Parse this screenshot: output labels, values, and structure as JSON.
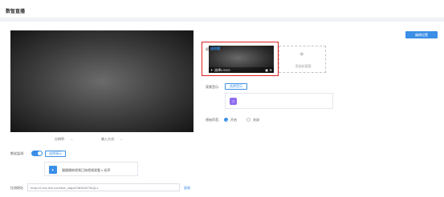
{
  "page": {
    "title": "数智直播",
    "primary_button": "编辑设置"
  },
  "preview": {
    "resolution_label": "分辨率:",
    "resolution_value": "--",
    "input_mode_label": "输入方式:",
    "input_mode_value": "--"
  },
  "settings": {
    "auto_play_label": "数说监测:",
    "select_video_button": "选择演示",
    "info_text": "慢慢播映视频已按视频观看 n 份声",
    "pull_url_label": "拉流地址:",
    "pull_url_value": "rtmp://2.xxx-live.com/live_xtapi/13630/ATXkQLL",
    "copy_link": "复制"
  },
  "cover": {
    "label": "视频:",
    "brand_text": "迪知播",
    "caption": "选择LOGO",
    "add_label": "添加封面图"
  },
  "music": {
    "label": "背景音乐:",
    "select_button": "选择音乐"
  },
  "sound": {
    "label": "原始声音:",
    "on_label": "开启",
    "off_label": "关闭"
  },
  "colors": {
    "accent": "#3a8ee6",
    "highlight": "#e02020"
  }
}
